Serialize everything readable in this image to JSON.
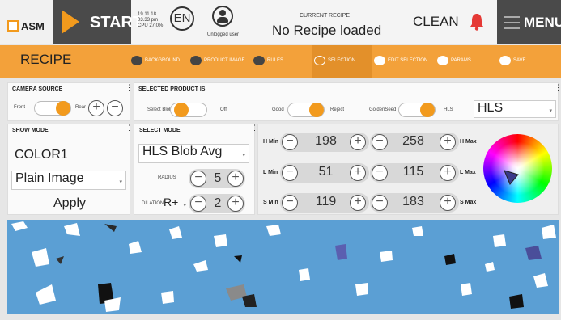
{
  "header": {
    "logo_text": "ASM",
    "start_label": "START",
    "sys_date": "19.11.18",
    "sys_time": "03.33 pm",
    "sys_cpu": "CPU 27.0%",
    "language": "EN",
    "user_label": "Unlogged user",
    "current_recipe_label": "CURRENT RECIPE",
    "current_recipe_value": "No Recipe loaded",
    "clean_label": "CLEAN",
    "menu_label": "MENU"
  },
  "recipe_bar": {
    "title": "RECIPE",
    "tabs": [
      "BACKGROUND",
      "PRODUCT IMAGE",
      "RULES",
      "SELECTION",
      "EDIT SELECTION",
      "PARAMS",
      "SAVE"
    ],
    "selected_tab": "SELECTION"
  },
  "camera_source": {
    "title": "CAMERA SOURCE",
    "left": "Front",
    "right": "Rear"
  },
  "selected_product": {
    "title": "SELECTED PRODUCT IS",
    "toggle1_left": "Select Blob",
    "toggle1_right": "Off",
    "toggle2_left": "Good",
    "toggle2_right": "Reject",
    "toggle3_left": "GoldenSeed",
    "toggle3_right": "HLS",
    "colorspace": "HLS"
  },
  "show_mode": {
    "title": "SHOW MODE",
    "value": "COLOR1",
    "image_mode": "Plain Image",
    "apply": "Apply"
  },
  "select_mode": {
    "title": "SELECT MODE",
    "mode": "HLS Blob Avg",
    "radius_label": "RADIUS",
    "radius_value": "5",
    "dilation_label": "DILATION",
    "dilation_mode": "R+",
    "dilation_value": "2"
  },
  "hls": {
    "h_min_label": "H Min",
    "h_min": "198",
    "h_max": "258",
    "h_max_label": "H Max",
    "l_min_label": "L Min",
    "l_min": "51",
    "l_max": "115",
    "l_max_label": "L Max",
    "s_min_label": "S Min",
    "s_min": "119",
    "s_max": "183",
    "s_max_label": "S Max"
  },
  "colors": {
    "accent": "#f3a13a",
    "dark": "#4a4a4a",
    "image_bg": "#5b9fd4",
    "alert": "#e53935"
  }
}
